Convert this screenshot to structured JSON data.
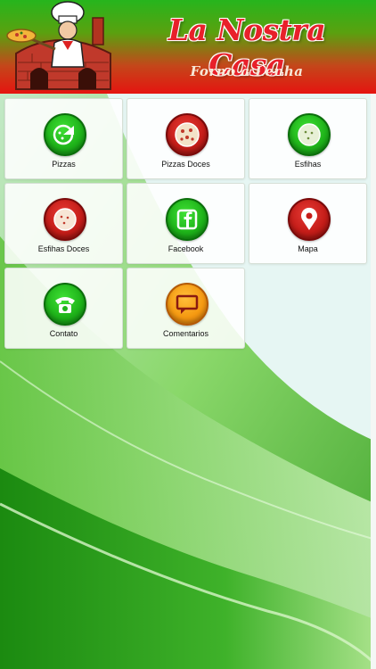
{
  "header": {
    "title": "La Nostra Casa",
    "subtitle": "Forno à Lenha",
    "logo_icon": "chef-oven-icon"
  },
  "menu": {
    "items": [
      {
        "label": "Pizzas",
        "icon": "pizza-slice-icon",
        "color": "#1fb41a"
      },
      {
        "label": "Pizzas Doces",
        "icon": "pizza-icon",
        "color": "#c51d19"
      },
      {
        "label": "Esfihas",
        "icon": "esfiha-icon",
        "color": "#1fb41a"
      },
      {
        "label": "Esfihas Doces",
        "icon": "esfiha-icon",
        "color": "#c51d19"
      },
      {
        "label": "Facebook",
        "icon": "facebook-icon",
        "color": "#1fb41a"
      },
      {
        "label": "Mapa",
        "icon": "map-pin-icon",
        "color": "#c51d19"
      },
      {
        "label": "Contato",
        "icon": "telephone-icon",
        "color": "#1fb41a"
      },
      {
        "label": "Comentarios",
        "icon": "comment-icon",
        "color": "#f59a12"
      }
    ]
  }
}
